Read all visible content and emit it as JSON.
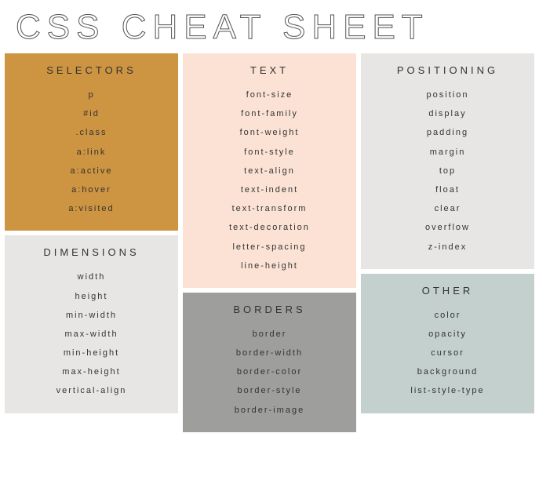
{
  "title": "CSS CHEAT SHEET",
  "sections": {
    "selectors": {
      "heading": "SELECTORS",
      "items": [
        "p",
        "#id",
        ".class",
        "a:link",
        "a:active",
        "a:hover",
        "a:visited"
      ]
    },
    "dimensions": {
      "heading": "DIMENSIONS",
      "items": [
        "width",
        "height",
        "min-width",
        "max-width",
        "min-height",
        "max-height",
        "vertical-align"
      ]
    },
    "text": {
      "heading": "TEXT",
      "items": [
        "font-size",
        "font-family",
        "font-weight",
        "font-style",
        "text-align",
        "text-indent",
        "text-transform",
        "text-decoration",
        "letter-spacing",
        "line-height"
      ]
    },
    "borders": {
      "heading": "BORDERS",
      "items": [
        "border",
        "border-width",
        "border-color",
        "border-style",
        "border-image"
      ]
    },
    "positioning": {
      "heading": "POSITIONING",
      "items": [
        "position",
        "display",
        "padding",
        "margin",
        "top",
        "float",
        "clear",
        "overflow",
        "z-index"
      ]
    },
    "other": {
      "heading": "OTHER",
      "items": [
        "color",
        "opacity",
        "cursor",
        "background",
        "list-style-type"
      ]
    }
  }
}
